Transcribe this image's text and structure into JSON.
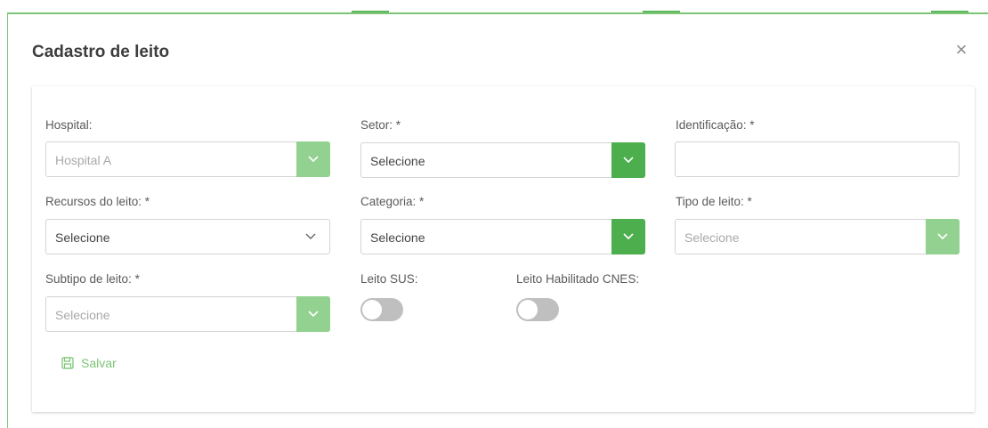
{
  "modal": {
    "title": "Cadastro de leito",
    "close_label": "×"
  },
  "form": {
    "hospital": {
      "label": "Hospital:",
      "value": "Hospital A"
    },
    "setor": {
      "label": "Setor: *",
      "value": "Selecione"
    },
    "identificacao": {
      "label": "Identificação: *",
      "value": ""
    },
    "recursos": {
      "label": "Recursos do leito: *",
      "value": "Selecione"
    },
    "categoria": {
      "label": "Categoria: *",
      "value": "Selecione"
    },
    "tipo": {
      "label": "Tipo de leito: *",
      "value": "Selecione"
    },
    "subtipo": {
      "label": "Subtipo de leito: *",
      "value": "Selecione"
    },
    "leito_sus": {
      "label": "Leito SUS:",
      "checked": false
    },
    "leito_cnes": {
      "label": "Leito Habilitado CNES:",
      "checked": false
    }
  },
  "actions": {
    "save_label": "Salvar"
  },
  "colors": {
    "accent": "#4cae4c",
    "accent_light": "#92d18f",
    "save_text": "#7cc576",
    "toggle_off": "#bfbfbf"
  },
  "icons": [
    "close-icon",
    "chevron-down-icon",
    "save-icon"
  ]
}
